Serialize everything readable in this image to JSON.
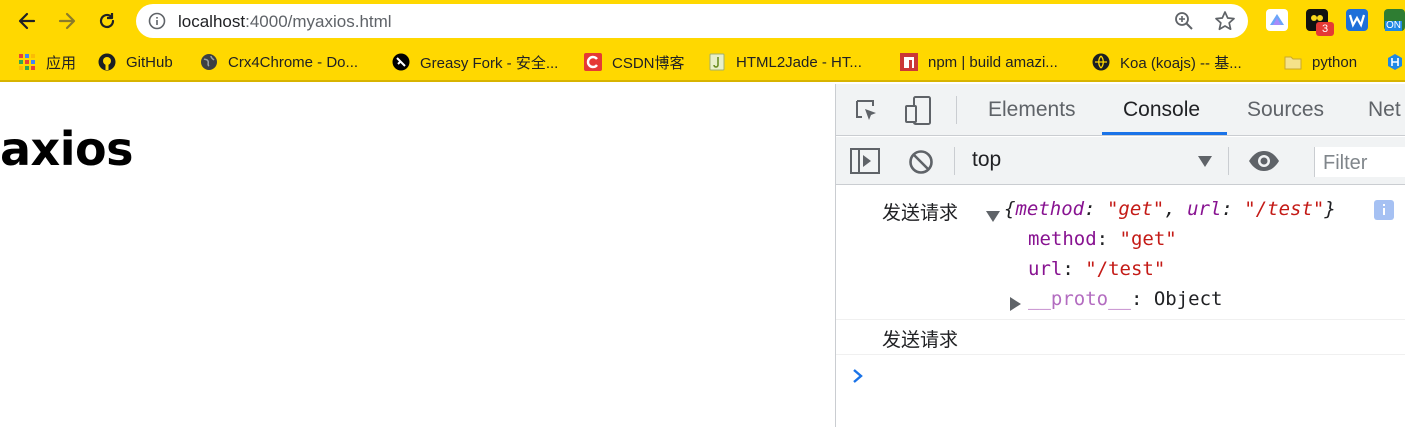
{
  "browser": {
    "url_host": "localhost",
    "url_rest": ":4000/myaxios.html",
    "extensions_badge": "3",
    "extensions_label": "ON"
  },
  "bookmarks": [
    {
      "label": "应用",
      "icon": "apps-grid-icon"
    },
    {
      "label": "GitHub",
      "icon": "github-icon"
    },
    {
      "label": "Crx4Chrome - Do...",
      "icon": "globe-icon"
    },
    {
      "label": "Greasy Fork - 安全...",
      "icon": "greasyfork-icon"
    },
    {
      "label": "CSDN博客",
      "icon": "csdn-icon"
    },
    {
      "label": "HTML2Jade - HT...",
      "icon": "html2jade-icon"
    },
    {
      "label": "npm | build amazi...",
      "icon": "npm-icon"
    },
    {
      "label": "Koa (koajs) -- 基...",
      "icon": "koa-icon"
    },
    {
      "label": "python",
      "icon": "folder-icon"
    }
  ],
  "page": {
    "heading": "axios"
  },
  "devtools": {
    "tabs": [
      "Elements",
      "Console",
      "Sources",
      "Net"
    ],
    "active_tab": "Console",
    "context": "top",
    "filter_placeholder": "Filter",
    "console": {
      "log1_label": "发送请求",
      "obj_open": "{",
      "obj_k1": "method",
      "obj_sep1": ": ",
      "obj_v1": "\"get\"",
      "obj_comma": ", ",
      "obj_k2": "url",
      "obj_sep2": ": ",
      "obj_v2": "\"/test\"",
      "obj_close": "}",
      "prop1_key": "method",
      "prop1_colon": ": ",
      "prop1_val": "\"get\"",
      "prop2_key": "url",
      "prop2_colon": ": ",
      "prop2_val": "\"/test\"",
      "proto_key": "__proto__",
      "proto_colon": ": ",
      "proto_val": "Object",
      "log2_label": "发送请求"
    },
    "colors": {
      "accent": "#1a73e8",
      "key": "#881391",
      "string": "#c41a16",
      "chrome_bg": "#ffd800"
    }
  }
}
